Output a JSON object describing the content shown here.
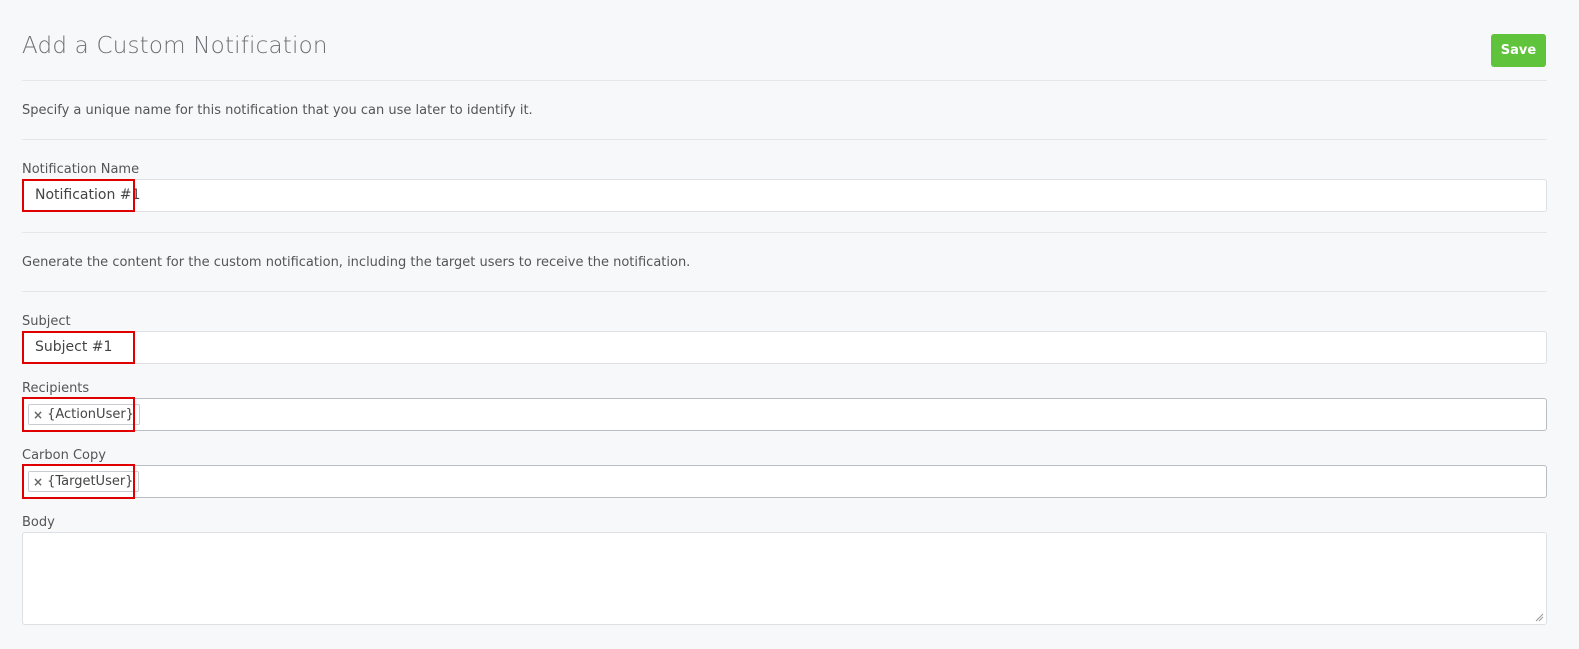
{
  "page": {
    "title": "Add a Custom Notification",
    "save_label": "Save"
  },
  "sections": {
    "name_description": "Specify a unique name for this notification that you can use later to identify it.",
    "content_description": "Generate the content for the custom notification, including the target users to receive the notification."
  },
  "form": {
    "notification_name": {
      "label": "Notification Name",
      "value": "Notification #1"
    },
    "subject": {
      "label": "Subject",
      "value": "Subject #1"
    },
    "recipients": {
      "label": "Recipients",
      "tags": [
        "{ActionUser}"
      ]
    },
    "carbon_copy": {
      "label": "Carbon Copy",
      "tags": [
        "{TargetUser}"
      ]
    },
    "body": {
      "label": "Body",
      "value": ""
    }
  },
  "colors": {
    "save_button": "#5fc33b",
    "highlight": "#e00000",
    "background": "#f7f8fa"
  }
}
